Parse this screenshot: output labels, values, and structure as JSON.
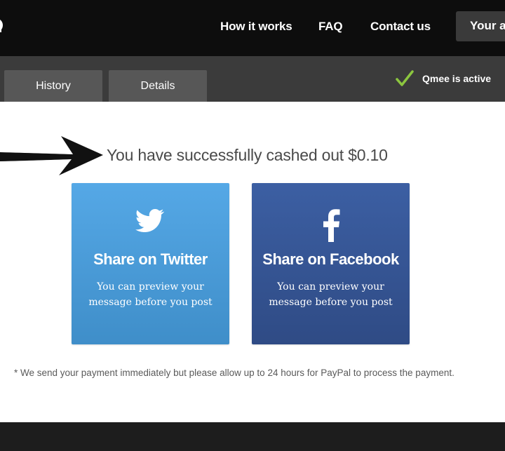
{
  "nav": {
    "links": [
      "How it works",
      "FAQ",
      "Contact us"
    ],
    "account_label": "Your a"
  },
  "tabs": [
    "History",
    "Details"
  ],
  "status": {
    "text": "Qmee is active",
    "color": "#8cc63f"
  },
  "main": {
    "headline": "You have successfully cashed out $0.10",
    "cards": [
      {
        "title": "Share on Twitter",
        "subtitle": "You can preview your message before you post",
        "icon": "twitter-bird-icon",
        "color": "#4a9cd9"
      },
      {
        "title": "Share on Facebook",
        "subtitle": "You can preview your message before you post",
        "icon": "facebook-f-icon",
        "color": "#35538f"
      }
    ],
    "footnote": "* We send your payment immediately but please allow up to 24 hours for PayPal to process the payment."
  }
}
